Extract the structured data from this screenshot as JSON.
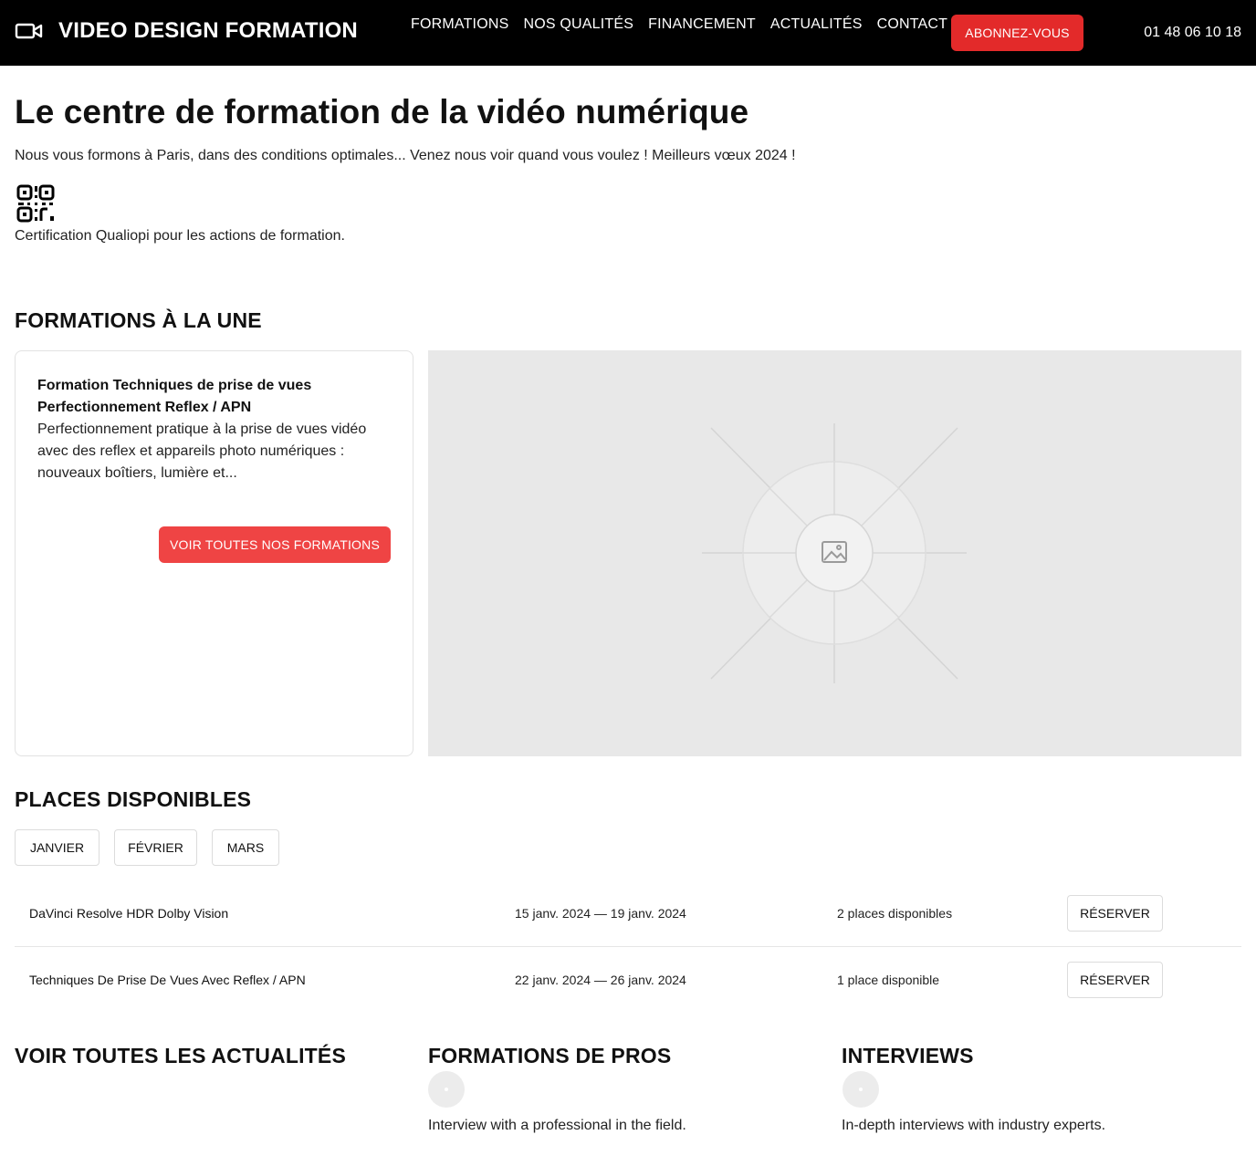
{
  "header": {
    "brand": "VIDEO DESIGN FORMATION",
    "brand_icon": "video-camera-icon",
    "nav": [
      "FORMATIONS",
      "NOS QUALITÉS",
      "FINANCEMENT",
      "ACTUALITÉS",
      "CONTACT"
    ],
    "subscribe_label": "ABONNEZ-VOUS",
    "phone": "01 48 06 10 18"
  },
  "hero": {
    "title": "Le centre de formation de la vidéo numérique",
    "subtitle": "Nous vous formons à Paris, dans des conditions optimales... Venez nous voir quand vous voulez ! Meilleurs vœux 2024 !",
    "cert_icon": "qr-code-icon",
    "certification": "Certification Qualiopi pour les actions de formation."
  },
  "featured": {
    "heading": "FORMATIONS À LA UNE",
    "card_title": "Formation Techniques de prise de vues Perfectionnement Reflex / APN",
    "card_description": "Perfectionnement pratique à la prise de vues vidéo avec des reflex et appareils photo numériques : nouveaux boîtiers, lumière et...",
    "cta_label": "VOIR TOUTES NOS FORMATIONS",
    "image_icon": "image-placeholder-icon"
  },
  "availability": {
    "heading": "PLACES DISPONIBLES",
    "months": [
      "JANVIER",
      "FÉVRIER",
      "MARS"
    ],
    "sessions": [
      {
        "name": "DaVinci Resolve HDR Dolby Vision",
        "dates": "15 janv. 2024 — 19 janv. 2024",
        "places": "2 places disponibles",
        "action": "RÉSERVER"
      },
      {
        "name": "Techniques De Prise De Vues Avec Reflex / APN",
        "dates": "22 janv. 2024 — 26 janv. 2024",
        "places": "1 place disponible",
        "action": "RÉSERVER"
      }
    ]
  },
  "columns": [
    {
      "heading": "VOIR TOUTES LES ACTUALITÉS",
      "text": ""
    },
    {
      "heading": "FORMATIONS DE PROS",
      "text": "Interview with a professional in the field."
    },
    {
      "heading": "INTERVIEWS",
      "text": "In-depth interviews with industry experts."
    }
  ],
  "colors": {
    "header_bg": "#000000",
    "accent_red": "#e32a2a",
    "cta_red": "#ef4444",
    "placeholder_gray": "#e8e8e8"
  }
}
